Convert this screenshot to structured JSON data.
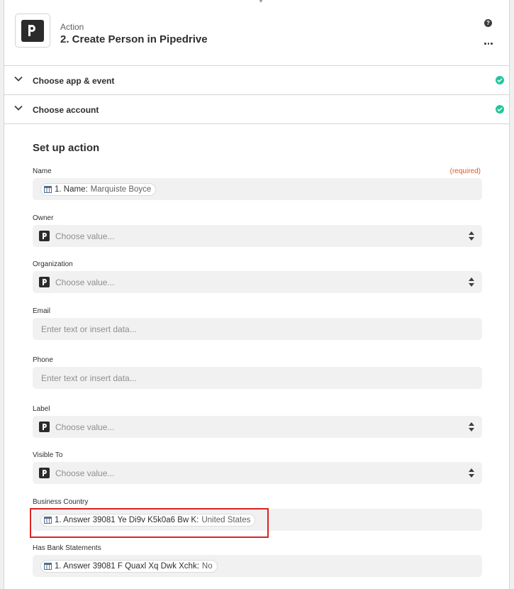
{
  "header": {
    "step_kind": "Action",
    "step_title": "2. Create Person in Pipedrive",
    "help_glyph": "?",
    "app_icon": "pipedrive-logo"
  },
  "sections": [
    {
      "label": "Choose app & event",
      "status": "complete"
    },
    {
      "label": "Choose account",
      "status": "complete"
    }
  ],
  "setup": {
    "title": "Set up action",
    "fields": {
      "name": {
        "label": "Name",
        "required_label": "(required)",
        "pill_key": "1. Name:",
        "pill_value": "Marquiste Boyce"
      },
      "owner": {
        "label": "Owner",
        "placeholder": "Choose value..."
      },
      "organization": {
        "label": "Organization",
        "placeholder": "Choose value..."
      },
      "email": {
        "label": "Email",
        "placeholder": "Enter text or insert data..."
      },
      "phone": {
        "label": "Phone",
        "placeholder": "Enter text or insert data..."
      },
      "label": {
        "label": "Label",
        "placeholder": "Choose value..."
      },
      "visible_to": {
        "label": "Visible To",
        "placeholder": "Choose value..."
      },
      "business_country": {
        "label": "Business Country",
        "pill_key": "1. Answer 39081 Ye Di9v K5k0a6 Bw K:",
        "pill_value": "United States"
      },
      "has_bank_statements": {
        "label": "Has Bank Statements",
        "pill_key": "1. Answer 39081 F Quaxl Xq Dwk Xchk:",
        "pill_value": "No"
      }
    }
  },
  "colors": {
    "accent_check": "#25c69d",
    "required": "#e3571e",
    "highlight": "#e02020",
    "field_bg": "#f1f1f1"
  }
}
